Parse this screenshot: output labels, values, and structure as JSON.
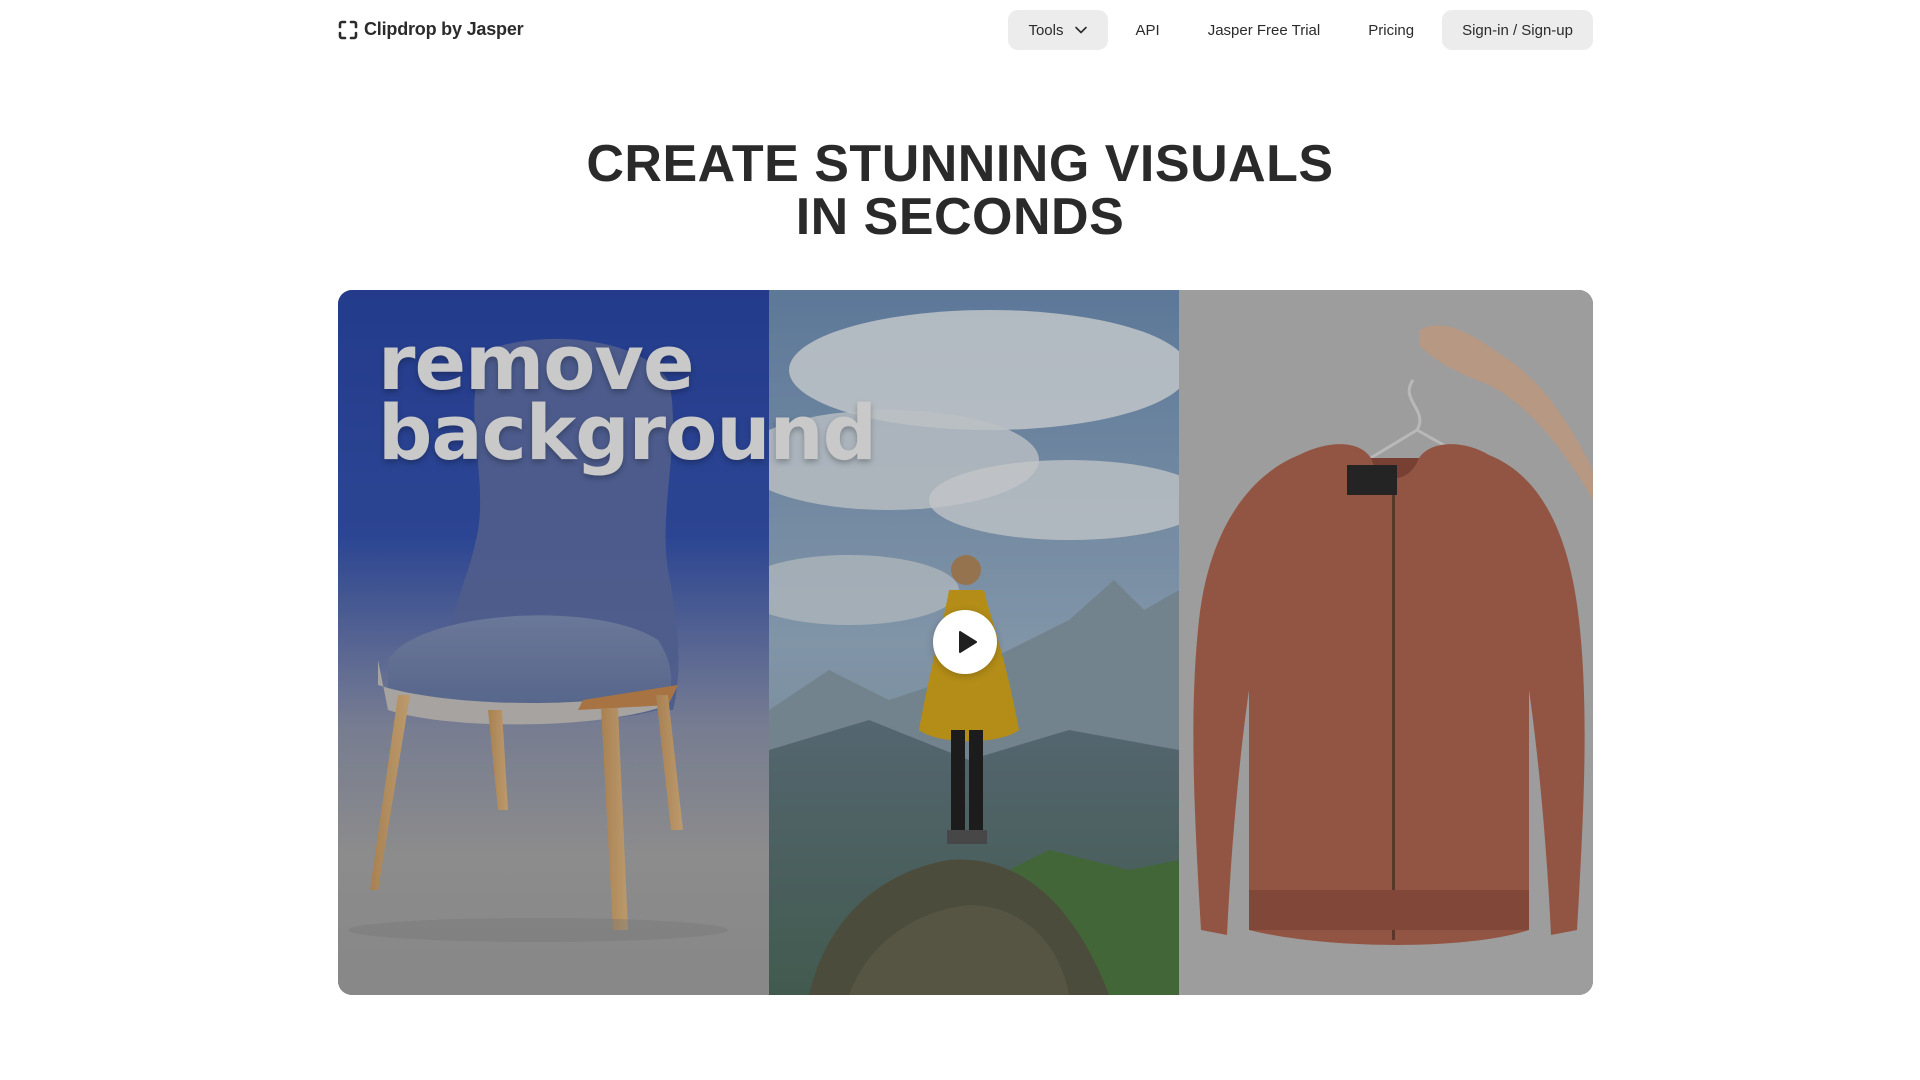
{
  "nav": {
    "logo_text": "Clipdrop by Jasper",
    "items": [
      {
        "label": "Tools",
        "has_dropdown": true,
        "style": "pill"
      },
      {
        "label": "API"
      },
      {
        "label": "Jasper Free Trial"
      },
      {
        "label": "Pricing"
      },
      {
        "label": "Sign-in / Sign-up",
        "style": "pill"
      }
    ]
  },
  "hero": {
    "title_line1": "CREATE STUNNING VISUALS",
    "title_line2": "IN SECONDS"
  },
  "video": {
    "overlay_line1": "remove",
    "overlay_line2": "background",
    "panels": [
      "blue-chair",
      "hiker-on-mountain",
      "orange-jacket-on-hanger"
    ]
  },
  "colors": {
    "text": "#2a2a2a",
    "pill_bg": "#ececec",
    "chair_bg": "#2c4aa8",
    "jacket": "#b46a55"
  }
}
